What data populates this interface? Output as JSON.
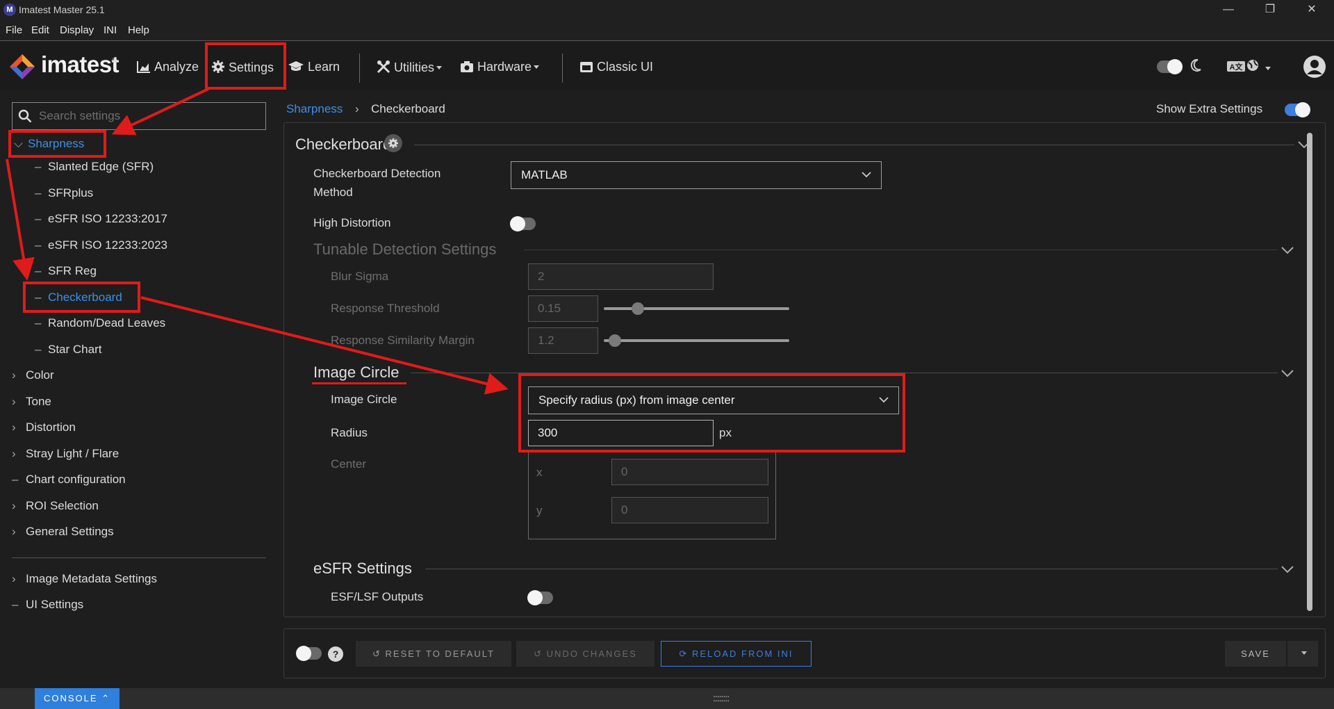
{
  "window": {
    "title": "Imatest Master 25.1",
    "icon_letter": "M",
    "minimize": "—",
    "maximize": "❐",
    "close": "✕"
  },
  "menu": [
    "File",
    "Edit",
    "Display",
    "INI",
    "Help"
  ],
  "nav": {
    "logo_text": "imatest",
    "logo_reg": "®",
    "items": [
      {
        "label": "Analyze",
        "icon": "chart-area-icon"
      },
      {
        "label": "Settings",
        "icon": "gear-icon"
      },
      {
        "label": "Learn",
        "icon": "graduation-cap-icon"
      },
      {
        "label": "Utilities",
        "icon": "tools-icon"
      },
      {
        "label": "Hardware",
        "icon": "camera-icon"
      },
      {
        "label": "Classic UI",
        "icon": "window-icon"
      }
    ],
    "theme_toggle_on": true,
    "accent_color": "#3d7ee0"
  },
  "sidebar": {
    "search_placeholder": "Search settings",
    "sharpness": {
      "label": "Sharpness",
      "children": [
        "Slanted Edge (SFR)",
        "SFRplus",
        "eSFR ISO 12233:2017",
        "eSFR ISO 12233:2023",
        "SFR Reg",
        "Checkerboard",
        "Random/Dead Leaves",
        "Star Chart"
      ],
      "selected": "Checkerboard"
    },
    "groups": [
      "Color",
      "Tone",
      "Distortion",
      "Stray Light / Flare",
      "Chart configuration",
      "ROI Selection",
      "General Settings"
    ],
    "bottom_groups": [
      "Image Metadata Settings",
      "UI Settings"
    ]
  },
  "breadcrumb": {
    "parent": "Sharpness",
    "current": "Checkerboard",
    "separator": "›"
  },
  "show_extra_settings": {
    "label": "Show Extra Settings",
    "on": true
  },
  "panel": {
    "title": "Checkerboard",
    "detection_method": {
      "label_line1": "Checkerboard Detection",
      "label_line2": "Method",
      "value": "MATLAB"
    },
    "high_distortion": {
      "label": "High Distortion",
      "on": false
    },
    "tunable": {
      "title": "Tunable Detection Settings",
      "blur_sigma": {
        "label": "Blur Sigma",
        "value": "2"
      },
      "response_threshold": {
        "label": "Response Threshold",
        "value": "0.15",
        "slider_fraction": 0.16
      },
      "response_similarity_margin": {
        "label": "Response Similarity Margin",
        "value": "1.2",
        "slider_fraction": 0.03
      }
    },
    "image_circle": {
      "title": "Image Circle",
      "mode_label": "Image Circle",
      "mode_value": "Specify radius (px) from image center",
      "radius_label": "Radius",
      "radius_value": "300",
      "radius_unit": "px",
      "center_label": "Center",
      "x_label": "x",
      "x_value": "0",
      "y_label": "y",
      "y_value": "0"
    },
    "esfr": {
      "title": "eSFR Settings",
      "outputs_label": "ESF/LSF Outputs",
      "outputs_on": false
    }
  },
  "footer": {
    "help": "?",
    "reset": "RESET TO DEFAULT",
    "undo": "UNDO CHANGES",
    "reload": "RELOAD FROM INI",
    "save": "SAVE"
  },
  "status": {
    "console": "CONSOLE",
    "grip": "::::::::"
  }
}
